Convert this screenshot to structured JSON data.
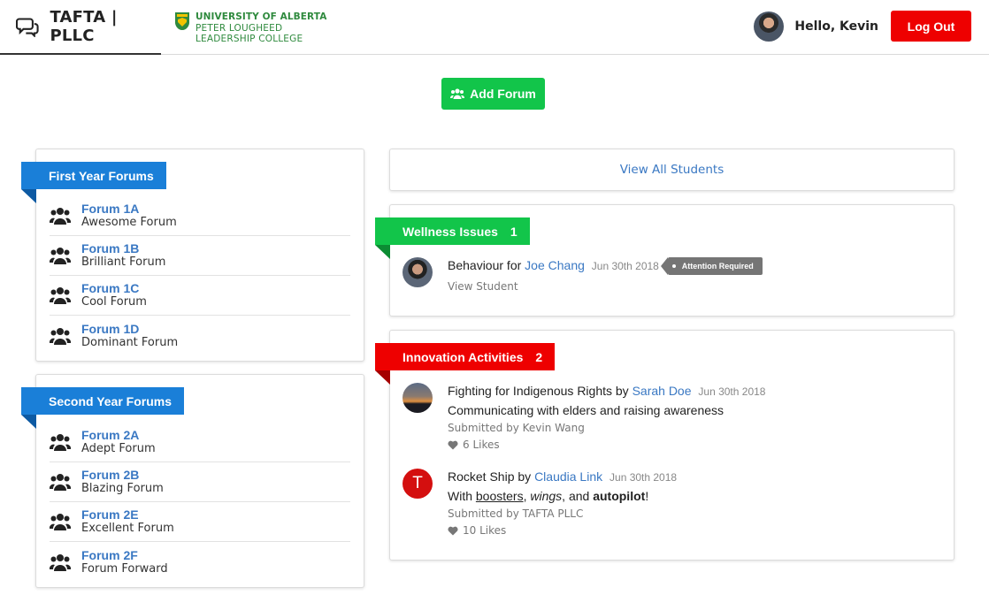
{
  "nav": {
    "brand": "TAFTA | PLLC",
    "university": {
      "line1": "UNIVERSITY OF ALBERTA",
      "line2": "PETER LOUGHEED",
      "line3": "LEADERSHIP COLLEGE"
    },
    "greeting": "Hello, Kevin",
    "logout_label": "Log Out"
  },
  "actions": {
    "add_forum_label": "Add Forum"
  },
  "first_year": {
    "title": "First Year Forums",
    "forums": [
      {
        "name": "Forum 1A",
        "description": "Awesome Forum"
      },
      {
        "name": "Forum 1B",
        "description": "Brilliant Forum"
      },
      {
        "name": "Forum 1C",
        "description": "Cool Forum"
      },
      {
        "name": "Forum 1D",
        "description": "Dominant Forum"
      }
    ]
  },
  "second_year": {
    "title": "Second Year Forums",
    "forums": [
      {
        "name": "Forum 2A",
        "description": "Adept Forum"
      },
      {
        "name": "Forum 2B",
        "description": "Blazing Forum"
      },
      {
        "name": "Forum 2E",
        "description": "Excellent Forum"
      },
      {
        "name": "Forum 2F",
        "description": "Forum Forward"
      }
    ]
  },
  "students": {
    "view_all_label": "View All Students"
  },
  "wellness": {
    "title": "Wellness Issues",
    "count": "1",
    "items": [
      {
        "title_prefix": "Behaviour for",
        "student": "Joe Chang",
        "date": "Jun 30th 2018",
        "tag": "Attention Required",
        "link": "View Student"
      }
    ]
  },
  "innovation": {
    "title": "Innovation Activities",
    "count": "2",
    "items": [
      {
        "title_prefix": "Fighting for Indigenous Rights by",
        "author": "Sarah Doe",
        "date": "Jun 30th 2018",
        "summary": "Communicating with elders and raising awareness",
        "submitted_by": "Submitted by Kevin Wang",
        "likes": "6 Likes"
      },
      {
        "title_prefix": "Rocket Ship by",
        "author": "Claudia Link",
        "date": "Jun 30th 2018",
        "summary_parts": {
          "with": "With ",
          "boosters": "boosters",
          "comma1": ", ",
          "wings": "wings",
          "and": ", and ",
          "autopilot": "autopilot",
          "end": "!"
        },
        "submitted_by": "Submitted by TAFTA PLLC",
        "likes": "10 Likes",
        "avatar_initial": "T"
      }
    ]
  },
  "colors": {
    "primary_link": "#3a78c3",
    "ribbon_blue": "#1a7fd8",
    "ribbon_green": "#12c54a",
    "ribbon_red": "#ee0000",
    "logout_red": "#ee0000",
    "tag_gray": "#757575"
  },
  "icons": {
    "brand": "chat-bubbles-icon",
    "forum": "users-group-icon",
    "like": "heart-icon",
    "university": "shield-crest-icon"
  }
}
